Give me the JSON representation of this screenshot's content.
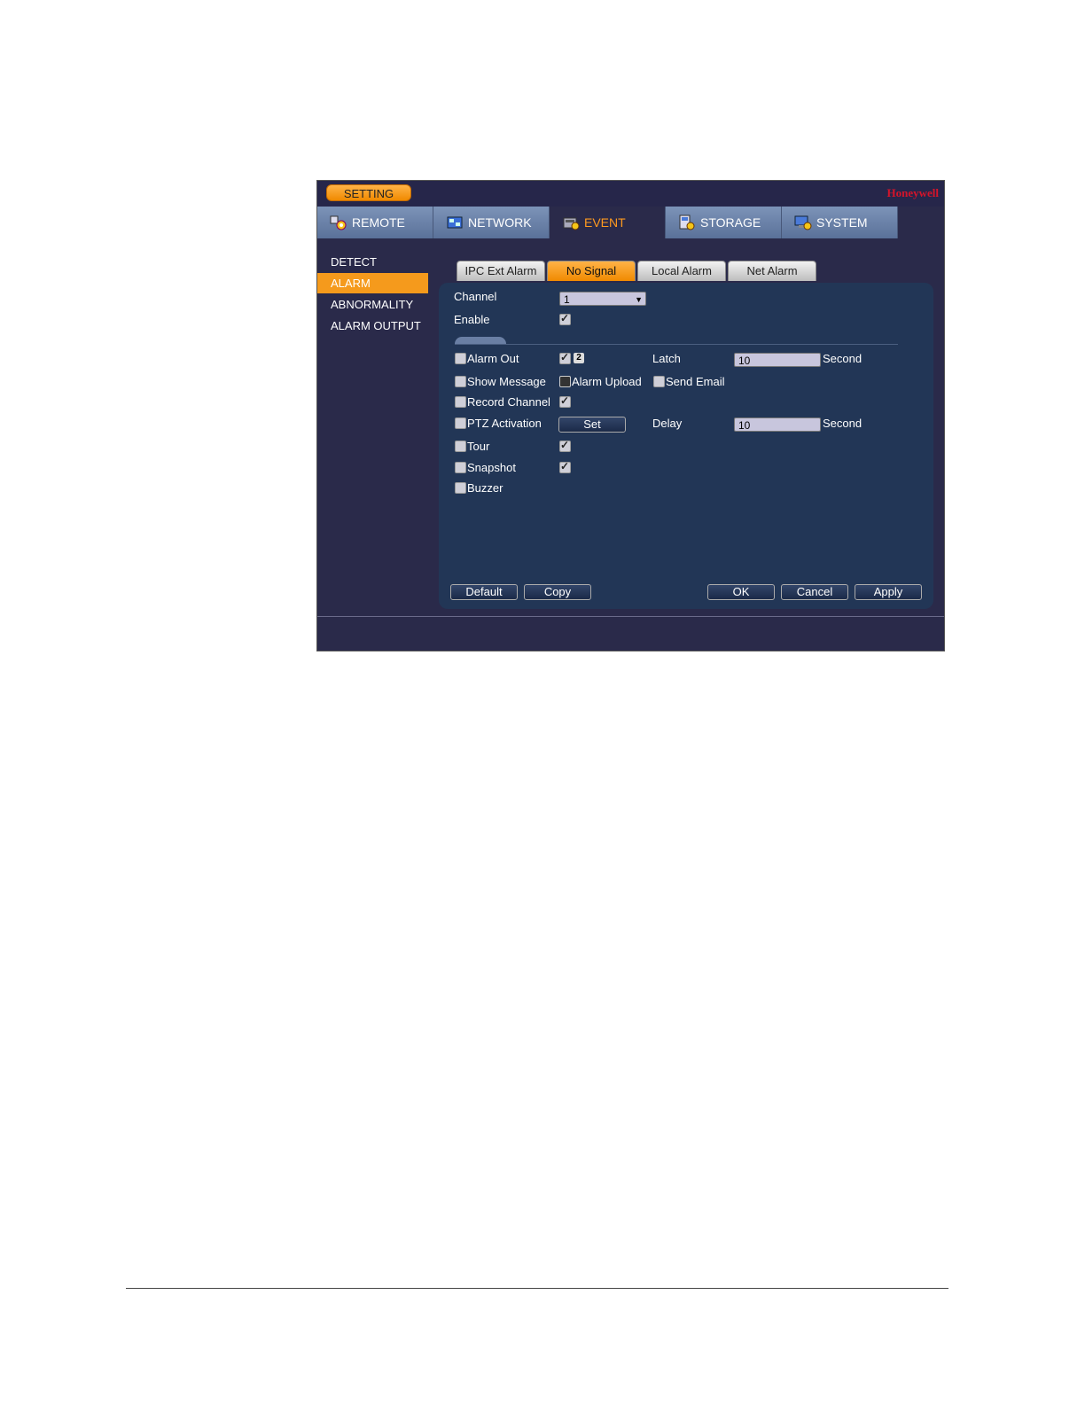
{
  "header": {
    "setting_label": "SETTING",
    "brand": "Honeywell"
  },
  "main_tabs": [
    {
      "label": "REMOTE",
      "icon": "remote-icon"
    },
    {
      "label": "NETWORK",
      "icon": "network-icon"
    },
    {
      "label": "EVENT",
      "icon": "event-icon",
      "active": true
    },
    {
      "label": "STORAGE",
      "icon": "storage-icon"
    },
    {
      "label": "SYSTEM",
      "icon": "system-icon"
    }
  ],
  "left_menu": [
    {
      "label": "DETECT"
    },
    {
      "label": "ALARM",
      "active": true
    },
    {
      "label": "ABNORMALITY"
    },
    {
      "label": "ALARM OUTPUT"
    }
  ],
  "sub_tabs": [
    {
      "label": "IPC Ext Alarm"
    },
    {
      "label": "No Signal",
      "active": true
    },
    {
      "label": "Local Alarm"
    },
    {
      "label": "Net Alarm"
    }
  ],
  "form": {
    "channel_label": "Channel",
    "channel_value": "1",
    "enable_label": "Enable",
    "enable_checked": true,
    "alarm_out_label": "Alarm Out",
    "alarm_out_channel": "2",
    "latch_label": "Latch",
    "latch_value": "10",
    "second_label_1": "Second",
    "show_message_label": "Show Message",
    "alarm_upload_label": "Alarm Upload",
    "send_email_label": "Send Email",
    "record_channel_label": "Record Channel",
    "ptz_activation_label": "PTZ Activation",
    "set_label": "Set",
    "delay_label": "Delay",
    "delay_value": "10",
    "second_label_2": "Second",
    "tour_label": "Tour",
    "snapshot_label": "Snapshot",
    "buzzer_label": "Buzzer"
  },
  "buttons": {
    "default": "Default",
    "copy": "Copy",
    "ok": "OK",
    "cancel": "Cancel",
    "apply": "Apply"
  },
  "colors": {
    "accent": "#f59a1c",
    "brand": "#d4142a",
    "panel": "#223656"
  }
}
